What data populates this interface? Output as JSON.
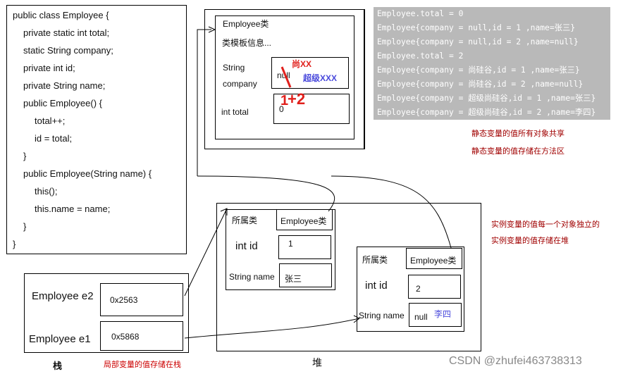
{
  "code": {
    "lines": [
      {
        "text": "public class Employee {",
        "indent": 0
      },
      {
        "text": "private static int total;",
        "indent": 1
      },
      {
        "text": "static String company;",
        "indent": 1
      },
      {
        "text": "private int id;",
        "indent": 1
      },
      {
        "text": "private String name;",
        "indent": 1
      },
      {
        "text": "public Employee() {",
        "indent": 1
      },
      {
        "text": "total++;",
        "indent": 2
      },
      {
        "text": "id = total;",
        "indent": 2
      },
      {
        "text": "}",
        "indent": 1
      },
      {
        "text": "public Employee(String name) {",
        "indent": 1
      },
      {
        "text": "this();",
        "indent": 2
      },
      {
        "text": "this.name = name;",
        "indent": 2
      },
      {
        "text": "}",
        "indent": 1
      },
      {
        "text": "}",
        "indent": 0
      }
    ]
  },
  "method_area": {
    "title": "Employee类",
    "template": "类模板信息...",
    "company_label1": "String",
    "company_label2": "company",
    "company_null": "null",
    "company_v1": "尚XX",
    "company_v2": "超级XXX",
    "total_label": "int total",
    "total_v0": "0",
    "total_v1": "1",
    "total_v2": "+2"
  },
  "console": [
    "Employee.total = 0",
    "Employee{company = null,id = 1 ,name=张三}",
    "Employee{company = null,id = 2 ,name=null}",
    "Employee.total = 2",
    "Employee{company = 尚硅谷,id = 1 ,name=张三}",
    "Employee{company = 尚硅谷,id = 2 ,name=null}",
    "Employee{company = 超级尚硅谷,id = 1 ,name=张三}",
    "Employee{company = 超级尚硅谷,id = 2 ,name=李四}"
  ],
  "notes": {
    "static1": "静态变量的值所有对象共享",
    "static2": "静态变量的值存储在方法区",
    "inst1": "实例变量的值每一个对象独立的",
    "inst2": "实例变量的值存储在堆",
    "stack_note": "局部变量的值存储在栈"
  },
  "heap": {
    "label": "堆",
    "obj1": {
      "class_label": "所属类",
      "class": "Employee类",
      "id_label": "int id",
      "id": "1",
      "name_label": "String name",
      "name": "张三"
    },
    "obj2": {
      "class_label": "所属类",
      "class": "Employee类",
      "id_label": "int id",
      "id": "2",
      "name_label": "String name",
      "name_null": "null",
      "name": "李四"
    }
  },
  "stack": {
    "label": "栈",
    "e2_label": "Employee e2",
    "e2": "0x2563",
    "e1_label": "Employee e1",
    "e1": "0x5868"
  },
  "watermark": "CSDN @zhufei463738313",
  "colors": {
    "console_bg": "#b9b9b9",
    "note": "#a00000",
    "red_ink": "#e0201c",
    "blue_ink": "#4a4adc"
  }
}
